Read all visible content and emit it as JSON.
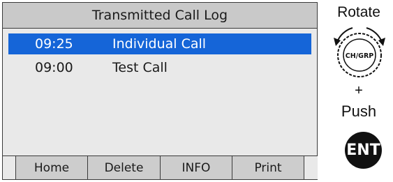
{
  "screen": {
    "title": "Transmitted Call Log",
    "entries": [
      {
        "time": "09:25",
        "name": "Individual Call",
        "selected": true
      },
      {
        "time": "09:00",
        "name": "Test Call",
        "selected": false
      }
    ],
    "softkeys": [
      "Home",
      "Delete",
      "INFO",
      "Print"
    ]
  },
  "controls": {
    "rotate_label": "Rotate",
    "knob_label": "CH/GRP",
    "plus_label": "+",
    "push_label": "Push",
    "ent_label": "ENT"
  },
  "colors": {
    "selection": "#1565d8",
    "title_bar": "#c9c9c9",
    "screen_bg": "#e9e9e9"
  }
}
